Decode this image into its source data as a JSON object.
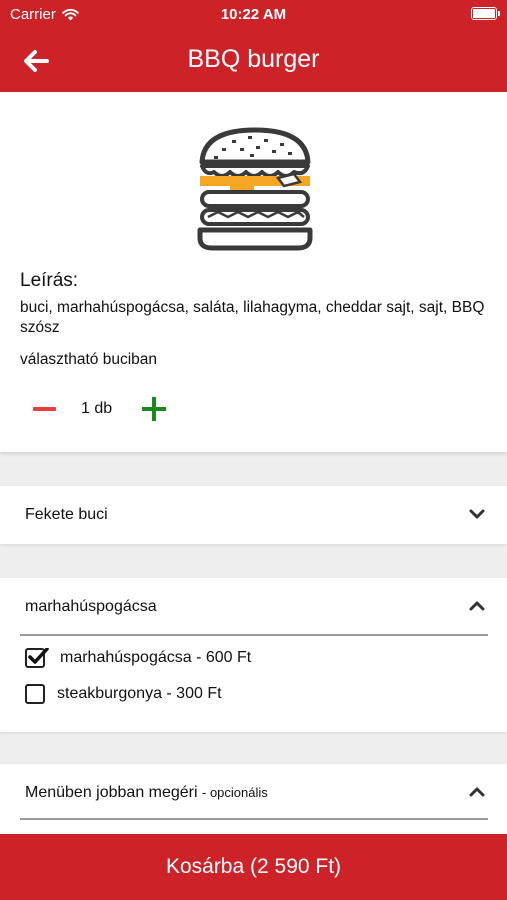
{
  "status_bar": {
    "carrier": "Carrier",
    "time": "10:22 AM",
    "icons": [
      "wifi-icon",
      "battery-icon"
    ]
  },
  "nav": {
    "title": "BBQ burger",
    "back_icon": "arrow-left-icon"
  },
  "product": {
    "image_icon": "burger-icon",
    "description_label": "Leírás:",
    "description": "buci, marhahúspogácsa, saláta, lilahagyma, cheddar sajt, sajt, BBQ szósz",
    "option_note": "választható buciban",
    "quantity": "1 db",
    "minus_icon": "minus-icon",
    "plus_icon": "plus-icon"
  },
  "sections": [
    {
      "title": "Fekete buci",
      "expanded": false,
      "chevron": "chevron-down-icon"
    },
    {
      "title": "marhahúspogácsa",
      "expanded": true,
      "chevron": "chevron-up-icon",
      "options": [
        {
          "label": "marhahúspogácsa - 600 Ft",
          "checked": true
        },
        {
          "label": "steakburgonya - 300 Ft",
          "checked": false
        }
      ]
    },
    {
      "title": "Menüben jobban megéri",
      "subtitle": "- opcionális",
      "expanded": true,
      "chevron": "chevron-up-icon"
    }
  ],
  "cart_button": "Kosárba (2 590 Ft)",
  "colors": {
    "brand_red": "#cd2228",
    "minus_red": "#e53e3e",
    "plus_green": "#1a8a1a",
    "cheese_orange": "#f5a623"
  }
}
